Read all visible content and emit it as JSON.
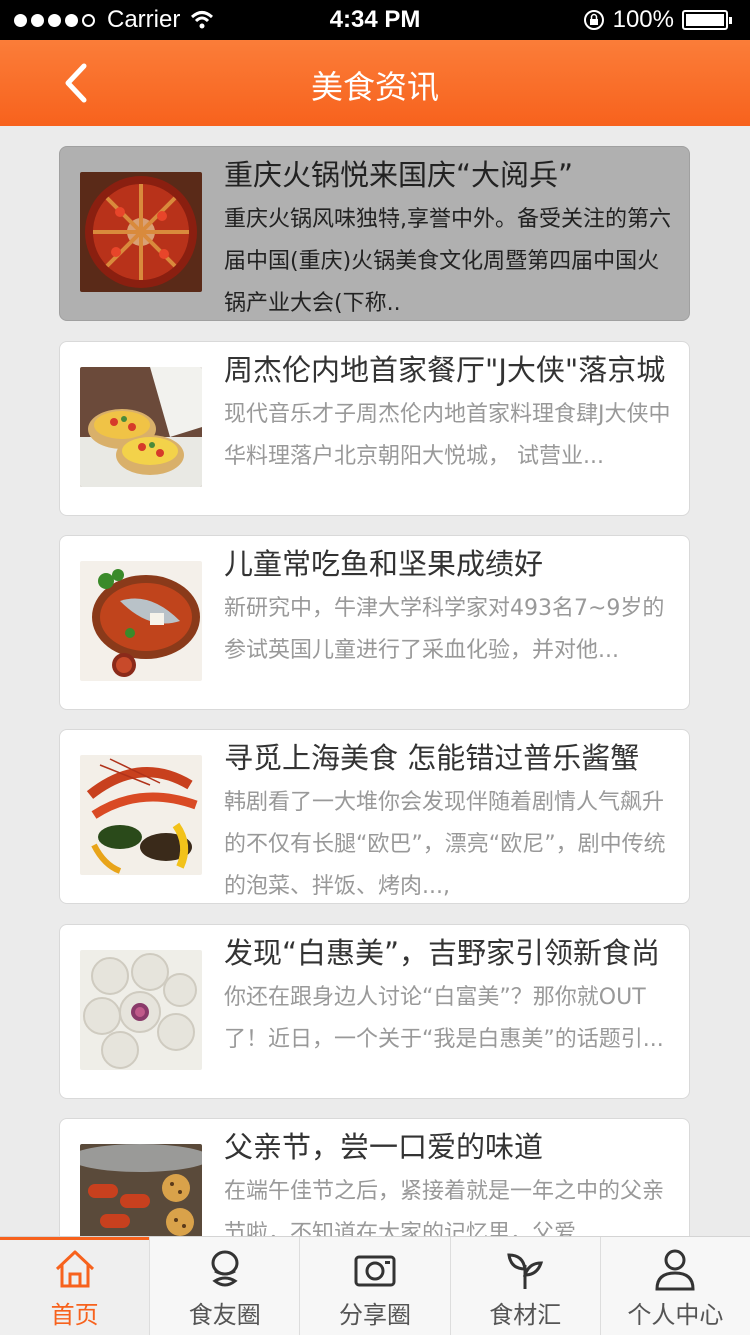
{
  "status_bar": {
    "carrier": "Carrier",
    "time": "4:34 PM",
    "battery": "100%"
  },
  "header": {
    "title": "美食资讯"
  },
  "articles": [
    {
      "title": "重庆火锅悦来国庆“大阅兵”",
      "desc": "重庆火锅风味独特,享誉中外。备受关注的第六届中国(重庆)火锅美食文化周暨第四届中国火锅产业大会(下称..",
      "thumb": "hotpot"
    },
    {
      "title": "周杰伦内地首家餐厅\"J大侠\"落京城",
      "desc": "现代音乐才子周杰伦内地首家料理食肆J大侠中华料理落户北京朝阳大悦城， 试营业...",
      "thumb": "canape"
    },
    {
      "title": "儿童常吃鱼和坚果成绩好",
      "desc": "新研究中，牛津大学科学家对493名7~9岁的参试英国儿童进行了采血化验，并对他...",
      "thumb": "fish"
    },
    {
      "title": "寻觅上海美食  怎能错过普乐酱蟹",
      "desc": "韩剧看了一大堆你会发现伴随着剧情人气飙升的不仅有长腿“欧巴”，漂亮“欧尼”，剧中传统的泡菜、拌饭、烤肉...,",
      "thumb": "shrimp"
    },
    {
      "title": "发现“白惠美”，吉野家引领新食尚",
      "desc": "你还在跟身边人讨论“白富美”？那你就OUT了！近日，一个关于“我是白惠美”的话题引...",
      "thumb": "mooncake"
    },
    {
      "title": "父亲节，尝一口爱的味道",
      "desc": "在端午佳节之后，紧接着就是一年之中的父亲节啦，不知道在大家的记忆里，父爱",
      "thumb": "grill"
    }
  ],
  "tabs": [
    {
      "label": "首页",
      "icon": "home-icon",
      "active": true
    },
    {
      "label": "食友圈",
      "icon": "chef-icon",
      "active": false
    },
    {
      "label": "分享圈",
      "icon": "camera-icon",
      "active": false
    },
    {
      "label": "食材汇",
      "icon": "sprout-icon",
      "active": false
    },
    {
      "label": "个人中心",
      "icon": "person-icon",
      "active": false
    }
  ],
  "colors": {
    "accent": "#f7621d",
    "background": "#ebebeb"
  }
}
